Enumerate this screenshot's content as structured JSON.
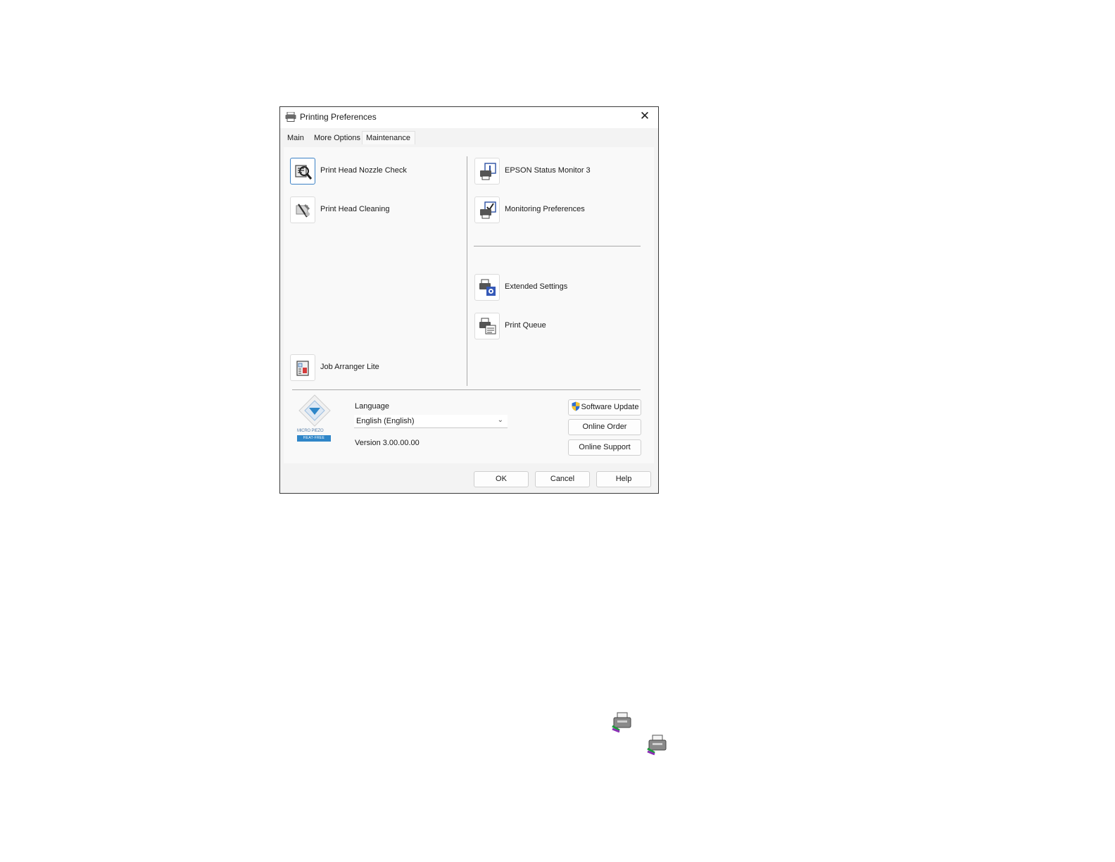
{
  "window": {
    "title": "Printing Preferences",
    "close_glyph": "✕"
  },
  "tabs": [
    {
      "label": "Main",
      "active": false
    },
    {
      "label": "More Options",
      "active": false
    },
    {
      "label": "Maintenance",
      "active": true
    }
  ],
  "left_tools": [
    {
      "label": "Print Head Nozzle Check",
      "icon": "nozzle-check-icon",
      "selected": true
    },
    {
      "label": "Print Head Cleaning",
      "icon": "head-cleaning-icon",
      "selected": false
    },
    {
      "label": "Job Arranger Lite",
      "icon": "job-arranger-icon",
      "selected": false
    }
  ],
  "right_tools": [
    {
      "label": "EPSON Status Monitor 3",
      "icon": "status-monitor-icon"
    },
    {
      "label": "Monitoring Preferences",
      "icon": "monitoring-preferences-icon"
    },
    {
      "label": "Extended Settings",
      "icon": "extended-settings-icon"
    },
    {
      "label": "Print Queue",
      "icon": "print-queue-icon"
    }
  ],
  "footer": {
    "logo": {
      "line1": "MICRO PIEZO",
      "line2": "HEAT-FREE",
      "icon": "micro-piezo-logo"
    },
    "language_label": "Language",
    "language_value": "English (English)",
    "version": "Version 3.00.00.00",
    "software_update": "Software Update",
    "online_order": "Online Order",
    "online_support": "Online Support"
  },
  "buttons": {
    "ok": "OK",
    "cancel": "Cancel",
    "help": "Help"
  },
  "colors": {
    "accent": "#3c82c6",
    "dialog_bg": "#f3f3f3",
    "panel_bg": "#f9f9f9"
  }
}
